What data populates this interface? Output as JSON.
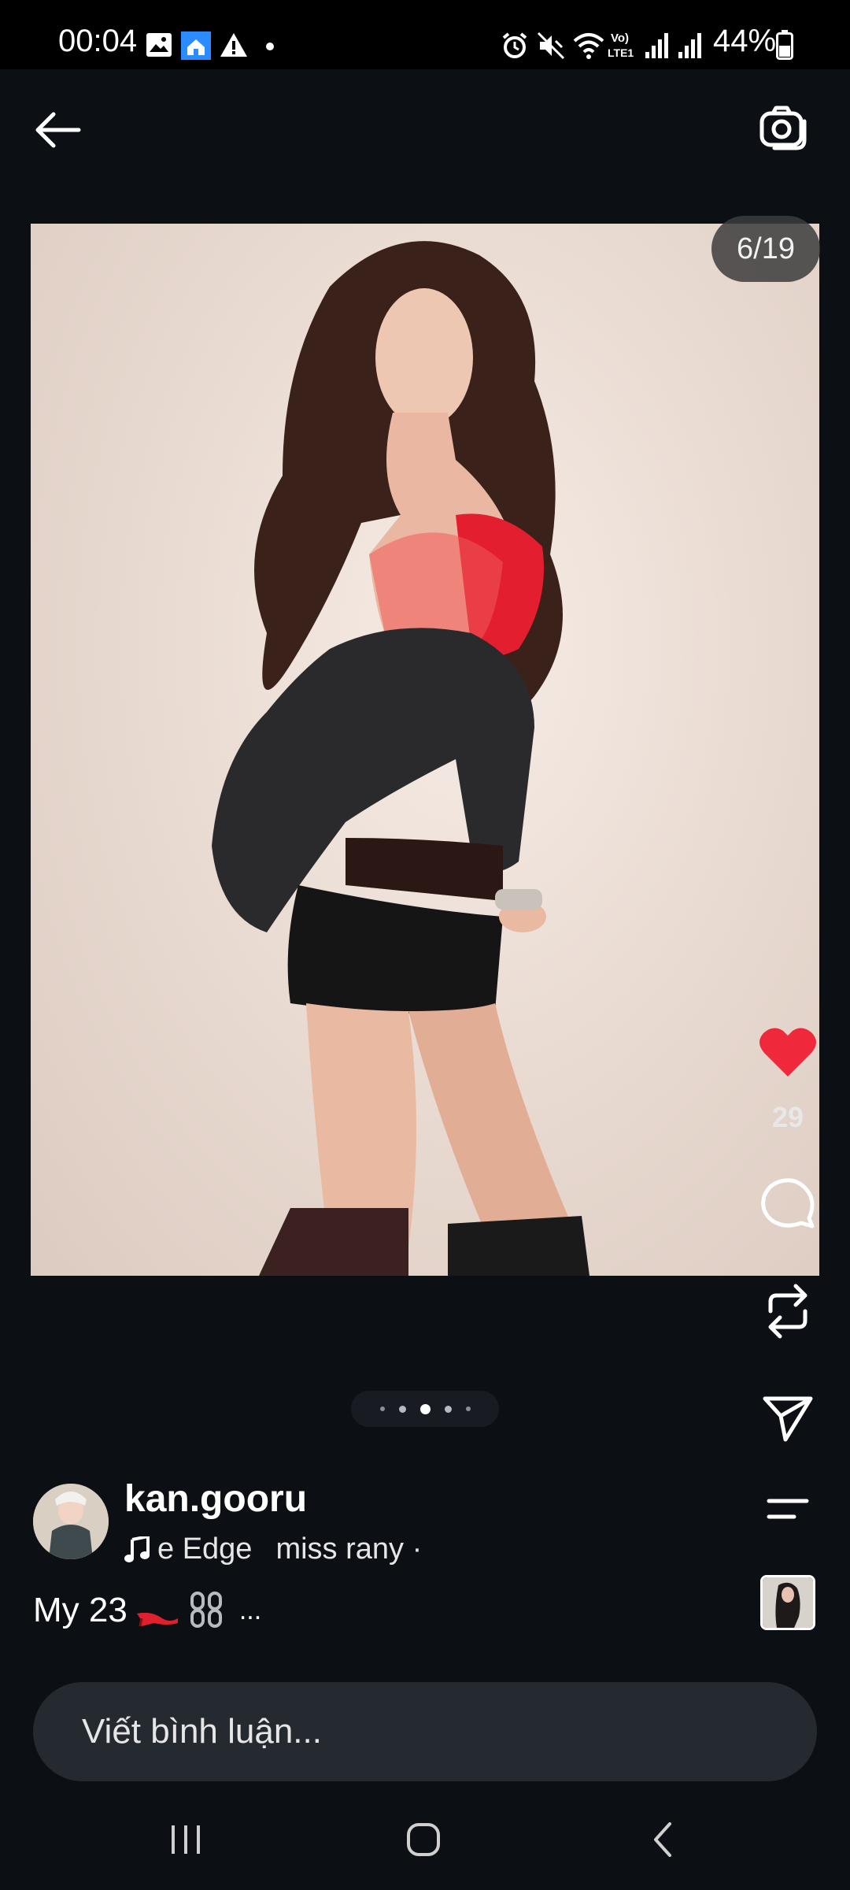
{
  "status_bar": {
    "time": "00:04",
    "battery": "44%"
  },
  "media": {
    "counter": "6/19",
    "image_icon": "photo-of-woman-in-red-top-and-black-leather-jacket"
  },
  "actions": {
    "like_count": "29",
    "liked": true,
    "like_color": "#f0283c"
  },
  "pagination": {
    "total_dots": 5,
    "active_index": 2
  },
  "post": {
    "username": "kan.gooru",
    "music_title": "e Edge",
    "music_artist": "miss rany ·",
    "caption_text": "My 23",
    "caption_more": "..."
  },
  "comment": {
    "placeholder": "Viết bình luận..."
  },
  "colors": {
    "background": "#0c1015",
    "input_bg": "#252a31"
  }
}
